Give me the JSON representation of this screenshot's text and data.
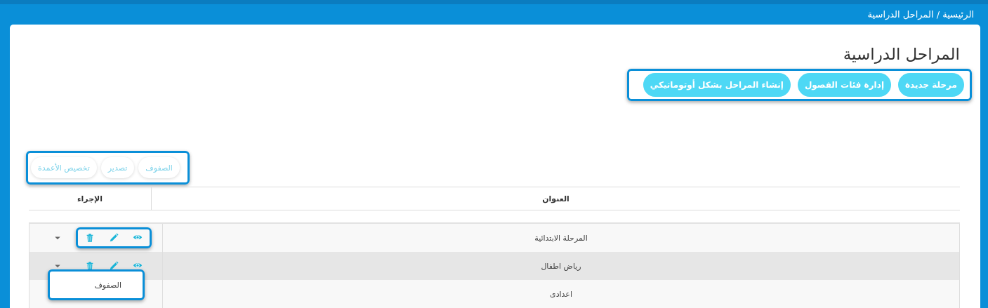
{
  "breadcrumb": "الرئيسية / المراحل الدراسية",
  "page_title": "المراحل الدراسية",
  "actions": {
    "highlighted": true,
    "buttons": [
      "مرحلة جديدة",
      "إدارة فئات الفصول",
      "إنشاء المراحل بشكل أوتوماتيكي"
    ]
  },
  "toolbar": {
    "highlighted": true,
    "buttons": [
      "الصفوف",
      "تصدير",
      "تخصيص الأعمدة"
    ]
  },
  "table": {
    "columns": [
      "العنوان",
      "الإجراء"
    ],
    "rows": [
      {
        "title": "المرحلة الابتدائية",
        "hovered": false,
        "actions_shown": true,
        "actions_highlighted": true
      },
      {
        "title": "رياض اطفال",
        "hovered": true,
        "actions_shown": true,
        "actions_highlighted": false
      },
      {
        "title": "اعدادى",
        "hovered": false
      }
    ]
  },
  "row_menu": {
    "highlighted": true,
    "items": [
      "الصفوف"
    ]
  }
}
